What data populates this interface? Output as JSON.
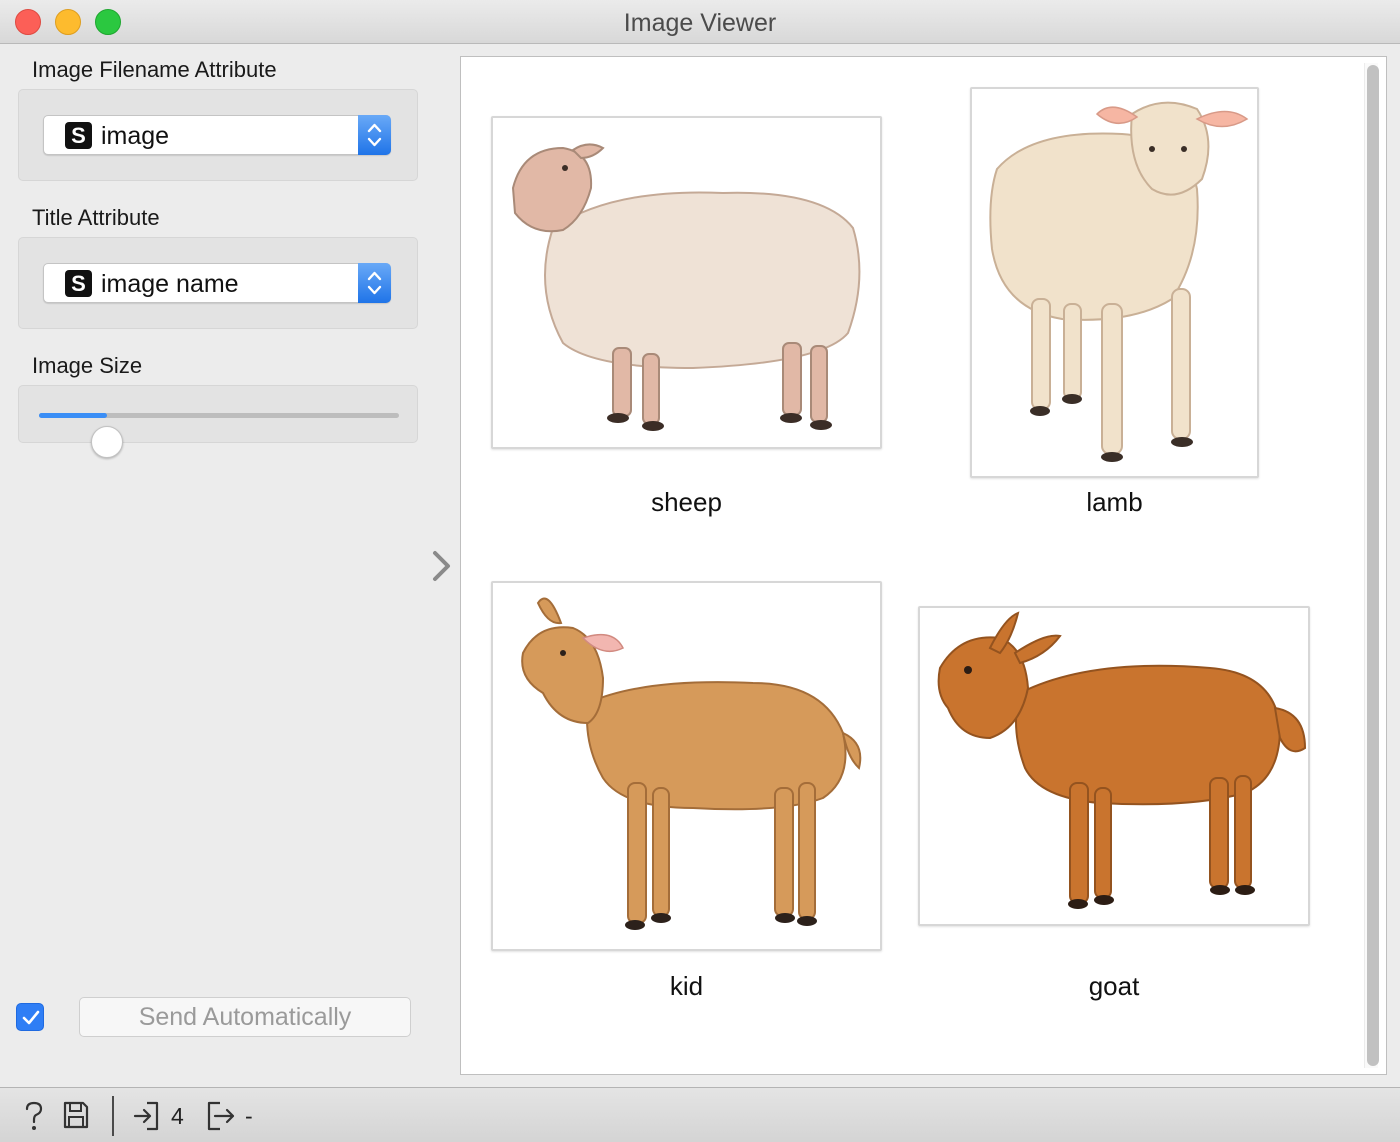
{
  "window": {
    "title": "Image Viewer",
    "controls": [
      "close-icon",
      "minimize-icon",
      "zoom-icon"
    ]
  },
  "controls": {
    "filename_attr": {
      "label": "Image Filename Attribute",
      "type_badge": "S",
      "selected": "image"
    },
    "title_attr": {
      "label": "Title Attribute",
      "type_badge": "S",
      "selected": "image name"
    },
    "image_size": {
      "label": "Image Size",
      "fraction": 0.19
    },
    "send_automatically": {
      "checked": true,
      "label": "Send Automatically"
    }
  },
  "images": [
    {
      "title": "sheep",
      "icon": "sheep-image"
    },
    {
      "title": "lamb",
      "icon": "lamb-image"
    },
    {
      "title": "kid",
      "icon": "kid-image"
    },
    {
      "title": "goat",
      "icon": "goat-image"
    }
  ],
  "status": {
    "input_count": "4",
    "output_count": "-"
  },
  "colors": {
    "accent": "#2f7ef5",
    "sheep_wool": "#efe2d6",
    "lamb_coat": "#f1e2cb",
    "kid_coat": "#d69a5a",
    "goat_coat": "#c9742e"
  }
}
